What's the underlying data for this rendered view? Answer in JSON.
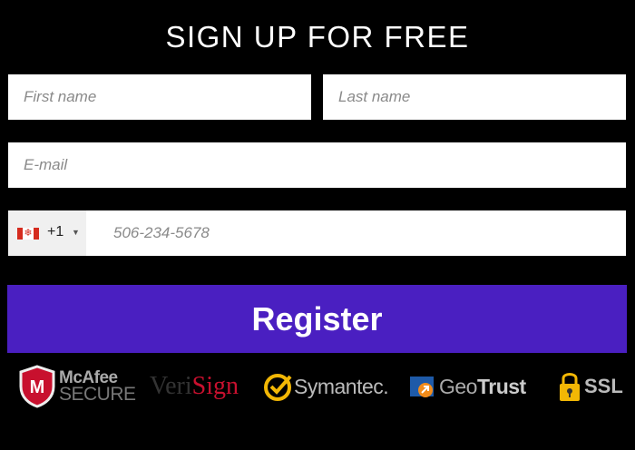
{
  "form": {
    "title": "SIGN UP FOR FREE",
    "first_name_placeholder": "First name",
    "last_name_placeholder": "Last name",
    "email_placeholder": "E-mail",
    "phone": {
      "country_flag": "canada-flag-icon",
      "dial_code": "+1",
      "placeholder": "506-234-5678"
    },
    "register_label": "Register"
  },
  "badges": {
    "mcafee": {
      "line1": "McAfee",
      "line2": "SECURE",
      "icon": "mcafee-shield-icon"
    },
    "verisign": {
      "part1": "Veri",
      "part2": "Sign"
    },
    "symantec": {
      "label": "Symantec.",
      "icon": "symantec-check-icon"
    },
    "geotrust": {
      "part1": "Geo",
      "part2": "Trust",
      "icon": "geotrust-arrow-icon"
    },
    "ssl": {
      "label": "SSL",
      "icon": "padlock-icon"
    }
  },
  "colors": {
    "background": "#000000",
    "button": "#4a1fc1",
    "text": "#ffffff"
  }
}
